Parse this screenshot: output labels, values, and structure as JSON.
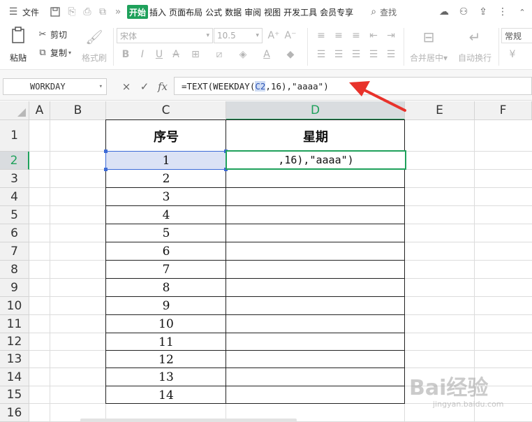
{
  "menubar": {
    "file": "文件",
    "tabs": [
      "开始",
      "插入",
      "页面布局",
      "公式",
      "数据",
      "审阅",
      "视图",
      "开发工具",
      "会员专享"
    ],
    "search": "查找"
  },
  "ribbon": {
    "paste": "粘贴",
    "cut": "剪切",
    "copy": "复制",
    "format_painter": "格式刷",
    "font_name": "宋体",
    "font_size": "10.5",
    "merge_center": "合并居中",
    "wrap_text": "自动换行",
    "number_format": "常规",
    "currency": "¥"
  },
  "formula": {
    "name_box": "WORKDAY",
    "cancel": "×",
    "confirm": "✓",
    "fx": "fx",
    "prefix": "=TEXT(WEEKDAY(",
    "ref": "C2",
    "suffix": ",16),\"aaaa\")"
  },
  "grid": {
    "columns": [
      "A",
      "B",
      "C",
      "D",
      "E",
      "F"
    ],
    "rows": [
      "1",
      "2",
      "3",
      "4",
      "5",
      "6",
      "7",
      "8",
      "9",
      "10",
      "11",
      "12",
      "13",
      "14",
      "15",
      "16"
    ],
    "header_c": "序号",
    "header_d": "星期",
    "c_values": [
      "1",
      "2",
      "3",
      "4",
      "5",
      "6",
      "7",
      "8",
      "9",
      "10",
      "11",
      "12",
      "13",
      "14"
    ],
    "d2_edit": ",16),\"aaaa\")"
  },
  "watermark": {
    "brand": "Bai经验",
    "url": "jingyan.baidu.com"
  }
}
